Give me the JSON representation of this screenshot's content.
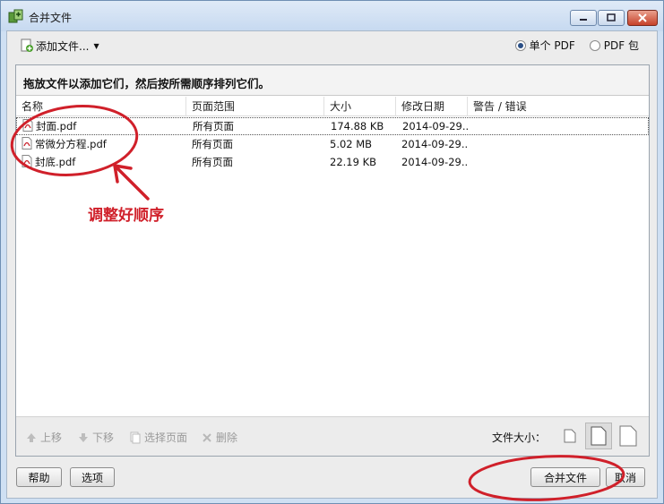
{
  "window": {
    "title": "合并文件"
  },
  "toolbar": {
    "add_label": "添加文件..."
  },
  "output_mode": {
    "single": "单个 PDF",
    "portfolio": "PDF 包",
    "selected": "single"
  },
  "instruction": "拖放文件以添加它们，然后按所需顺序排列它们。",
  "columns": [
    "名称",
    "页面范围",
    "大小",
    "修改日期",
    "警告 / 错误"
  ],
  "files": [
    {
      "name": "封面.pdf",
      "range": "所有页面",
      "size": "174.88 KB",
      "date": "2014-09-29..."
    },
    {
      "name": "常微分方程.pdf",
      "range": "所有页面",
      "size": "5.02 MB",
      "date": "2014-09-29..."
    },
    {
      "name": "封底.pdf",
      "range": "所有页面",
      "size": "22.19 KB",
      "date": "2014-09-29..."
    }
  ],
  "actions": {
    "up": "上移",
    "down": "下移",
    "select_pages": "选择页面",
    "delete": "删除"
  },
  "file_size": {
    "label": "文件大小："
  },
  "buttons": {
    "help": "帮助",
    "options": "选项",
    "combine": "合并文件",
    "cancel": "取消"
  },
  "annotation": {
    "text": "调整好顺序",
    "color": "#d0202a"
  }
}
